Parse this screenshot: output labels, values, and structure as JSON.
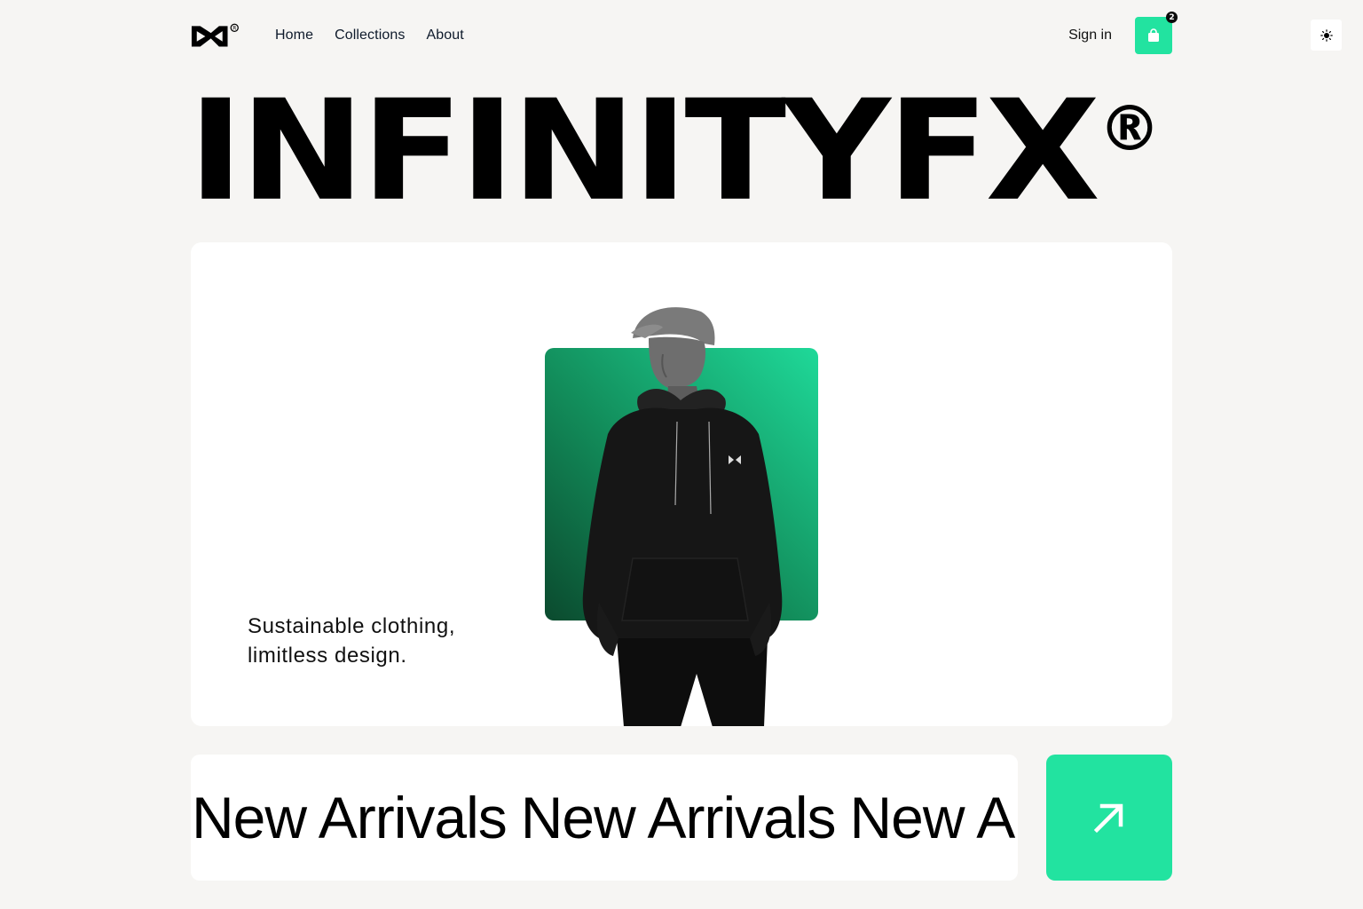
{
  "header": {
    "logo_icon": "infinityfx-bowtie-logo",
    "nav": [
      {
        "label": "Home"
      },
      {
        "label": "Collections"
      },
      {
        "label": "About"
      }
    ],
    "sign_in": "Sign in",
    "cart": {
      "icon": "shopping-bag-icon",
      "count": "2"
    },
    "theme_toggle_icon": "sun-icon"
  },
  "brand": {
    "name": "INFINITYFX",
    "registered": "®"
  },
  "hero": {
    "tagline_line1": "Sustainable clothing,",
    "tagline_line2": "limitless design.",
    "accent_color": "#22e3a0"
  },
  "arrivals": {
    "items": [
      "New Arrivals",
      "New Arrivals",
      "New Arrivals"
    ],
    "arrow_icon": "arrow-up-right-icon"
  }
}
